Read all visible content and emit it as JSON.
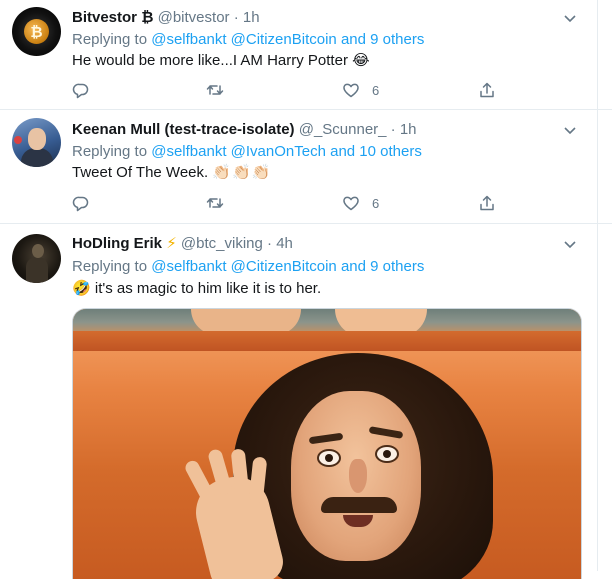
{
  "tweets": [
    {
      "name": "Bitvestor",
      "name_suffix": "₿",
      "handle": "@bitvestor",
      "sep": "·",
      "time": "1h",
      "replying_prefix": "Replying to",
      "mentions": [
        "@selfbankt",
        "@CitizenBitcoin"
      ],
      "others": "and 9 others",
      "text": "He would be more like...I AM Harry Potter",
      "emoji": "😂",
      "like_count": "6"
    },
    {
      "name": "Keenan Mull (test-trace-isolate)",
      "handle": "@_Scunner_",
      "sep": "·",
      "time": "1h",
      "replying_prefix": "Replying to",
      "mentions": [
        "@selfbankt",
        "@IvanOnTech"
      ],
      "others": "and 10 others",
      "text": "Tweet Of The Week.",
      "emoji": "👏🏻👏🏻👏🏻",
      "like_count": "6"
    },
    {
      "name": "HoDling Erik",
      "name_suffix": "⚡",
      "handle": "@btc_viking",
      "sep": "·",
      "time": "4h",
      "replying_prefix": "Replying to",
      "mentions": [
        "@selfbankt",
        "@CitizenBitcoin"
      ],
      "others": "and 9 others",
      "emoji": "🤣",
      "text": "it's as magic to him like it is to her."
    }
  ],
  "icons": {
    "reply": "reply-icon",
    "retweet": "retweet-icon",
    "like": "heart-icon",
    "share": "share-icon",
    "more": "chevron-down-icon"
  },
  "colors": {
    "link": "#1da1f2",
    "secondary_text": "#657786",
    "divider": "#e6ecf0"
  }
}
